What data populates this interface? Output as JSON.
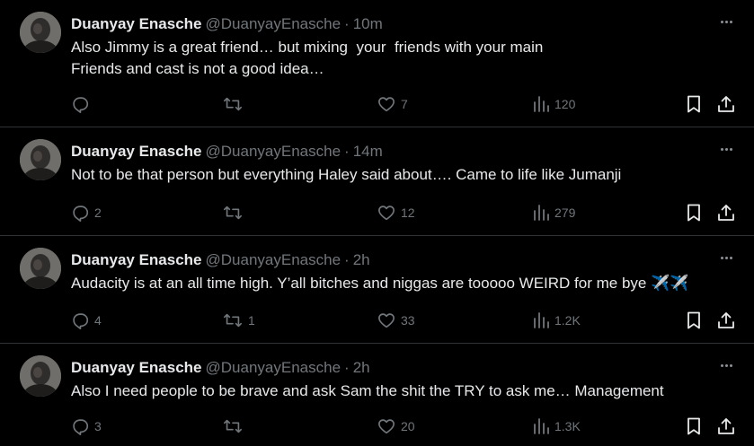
{
  "tweets": [
    {
      "name": "Duanyay Enasche",
      "handle": "@DuanyayEnasche",
      "separator": "·",
      "time": "10m",
      "text": "Also Jimmy is a great friend… but mixing  your  friends with your main\nFriends and cast is not a good idea…",
      "replies": "",
      "retweets": "",
      "likes": "7",
      "views": "120"
    },
    {
      "name": "Duanyay Enasche",
      "handle": "@DuanyayEnasche",
      "separator": "·",
      "time": "14m",
      "text": "Not to be that person but everything Haley said about…. Came to life like Jumanji",
      "replies": "2",
      "retweets": "",
      "likes": "12",
      "views": "279"
    },
    {
      "name": "Duanyay Enasche",
      "handle": "@DuanyayEnasche",
      "separator": "·",
      "time": "2h",
      "text": "Audacity is at an all time high. Y’all bitches and niggas are tooooo WEIRD for me bye ✈️✈️",
      "replies": "4",
      "retweets": "1",
      "likes": "33",
      "views": "1.2K"
    },
    {
      "name": "Duanyay Enasche",
      "handle": "@DuanyayEnasche",
      "separator": "·",
      "time": "2h",
      "text": "Also I need people to be brave and ask Sam the shit the TRY to ask me… Management",
      "replies": "3",
      "retweets": "",
      "likes": "20",
      "views": "1.3K"
    }
  ],
  "icons": {
    "more": "more-horizontal-icon",
    "reply": "reply-icon",
    "retweet": "retweet-icon",
    "like": "heart-icon",
    "views": "views-chart-icon",
    "bookmark": "bookmark-icon",
    "share": "share-icon"
  },
  "colors": {
    "background": "#000000",
    "text": "#e7e9ea",
    "secondary": "#71767b",
    "divider": "#2f3336"
  }
}
